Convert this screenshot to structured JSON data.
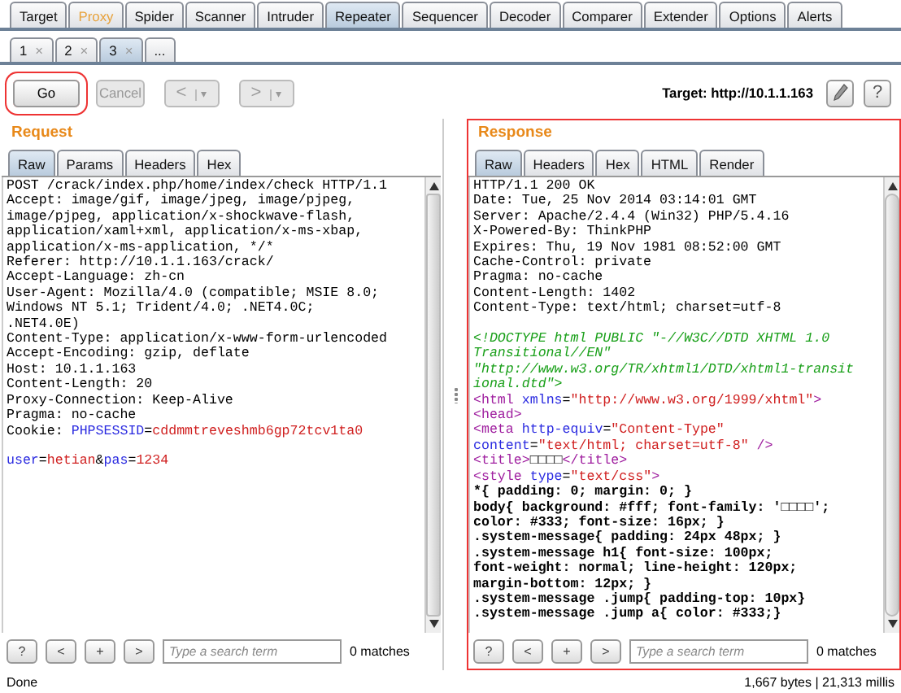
{
  "main_tabs": [
    {
      "label": "Target",
      "selected": false,
      "alert": false
    },
    {
      "label": "Proxy",
      "selected": false,
      "alert": true
    },
    {
      "label": "Spider",
      "selected": false,
      "alert": false
    },
    {
      "label": "Scanner",
      "selected": false,
      "alert": false
    },
    {
      "label": "Intruder",
      "selected": false,
      "alert": false
    },
    {
      "label": "Repeater",
      "selected": true,
      "alert": false
    },
    {
      "label": "Sequencer",
      "selected": false,
      "alert": false
    },
    {
      "label": "Decoder",
      "selected": false,
      "alert": false
    },
    {
      "label": "Comparer",
      "selected": false,
      "alert": false
    },
    {
      "label": "Extender",
      "selected": false,
      "alert": false
    },
    {
      "label": "Options",
      "selected": false,
      "alert": false
    },
    {
      "label": "Alerts",
      "selected": false,
      "alert": false
    }
  ],
  "sub_tabs": [
    {
      "label": "1",
      "close": "×",
      "selected": false
    },
    {
      "label": "2",
      "close": "×",
      "selected": false
    },
    {
      "label": "3",
      "close": "×",
      "selected": true
    },
    {
      "label": "...",
      "selected": false
    }
  ],
  "toolbar": {
    "go": {
      "label": "Go",
      "highlighted": true
    },
    "cancel": {
      "label": "Cancel",
      "disabled": true
    },
    "back": {
      "label": "<",
      "menu": "▾"
    },
    "forward": {
      "label": ">",
      "menu": "▾"
    },
    "target": "Target: http://10.1.1.163",
    "help": "?"
  },
  "request": {
    "title": "Request",
    "highlighted": false,
    "tabs": [
      {
        "label": "Raw",
        "selected": true
      },
      {
        "label": "Params",
        "selected": false
      },
      {
        "label": "Headers",
        "selected": false
      },
      {
        "label": "Hex",
        "selected": false
      }
    ],
    "lines": [
      {
        "segments": [
          {
            "text": "POST /crack/index.php/home/index/check HTTP/1.1",
            "kind": "plain"
          }
        ]
      },
      {
        "segments": [
          {
            "text": "Accept: image/gif, image/jpeg, image/pjpeg,",
            "kind": "plain"
          }
        ]
      },
      {
        "segments": [
          {
            "text": "image/pjpeg, application/x-shockwave-flash,",
            "kind": "plain"
          }
        ]
      },
      {
        "segments": [
          {
            "text": "application/xaml+xml, application/x-ms-xbap,",
            "kind": "plain"
          }
        ]
      },
      {
        "segments": [
          {
            "text": "application/x-ms-application, */*",
            "kind": "plain"
          }
        ]
      },
      {
        "segments": [
          {
            "text": "Referer: http://10.1.1.163/crack/",
            "kind": "plain"
          }
        ]
      },
      {
        "segments": [
          {
            "text": "Accept-Language: zh-cn",
            "kind": "plain"
          }
        ]
      },
      {
        "segments": [
          {
            "text": "User-Agent: Mozilla/4.0 (compatible; MSIE 8.0;",
            "kind": "plain"
          }
        ]
      },
      {
        "segments": [
          {
            "text": "Windows NT 5.1; Trident/4.0; .NET4.0C;",
            "kind": "plain"
          }
        ]
      },
      {
        "segments": [
          {
            "text": ".NET4.0E)",
            "kind": "plain"
          }
        ]
      },
      {
        "segments": [
          {
            "text": "Content-Type: application/x-www-form-urlencoded",
            "kind": "plain"
          }
        ]
      },
      {
        "segments": [
          {
            "text": "Accept-Encoding: gzip, deflate",
            "kind": "plain"
          }
        ]
      },
      {
        "segments": [
          {
            "text": "Host: 10.1.1.163",
            "kind": "plain"
          }
        ]
      },
      {
        "segments": [
          {
            "text": "Content-Length: 20",
            "kind": "plain"
          }
        ]
      },
      {
        "segments": [
          {
            "text": "Proxy-Connection: Keep-Alive",
            "kind": "plain"
          }
        ]
      },
      {
        "segments": [
          {
            "text": "Pragma: no-cache",
            "kind": "plain"
          }
        ]
      },
      {
        "segments": [
          {
            "text": "Cookie: ",
            "kind": "plain"
          },
          {
            "text": "PHPSESSID",
            "kind": "name"
          },
          {
            "text": "=",
            "kind": "plain"
          },
          {
            "text": "cddmmtreveshmb6gp72tcv1ta0",
            "kind": "value"
          }
        ]
      },
      {
        "blank_before": true,
        "segments": [
          {
            "text": "user",
            "kind": "name"
          },
          {
            "text": "=",
            "kind": "plain"
          },
          {
            "text": "hetian",
            "kind": "value"
          },
          {
            "text": "&",
            "kind": "plain"
          },
          {
            "text": "pas",
            "kind": "name"
          },
          {
            "text": "=",
            "kind": "plain"
          },
          {
            "text": "1234",
            "kind": "value"
          }
        ]
      }
    ],
    "search": {
      "help": "?",
      "prev": "<",
      "add": "+",
      "next": ">",
      "placeholder": "Type a search term",
      "matches": "0 matches"
    }
  },
  "response": {
    "title": "Response",
    "highlighted": true,
    "tabs": [
      {
        "label": "Raw",
        "selected": true
      },
      {
        "label": "Headers",
        "selected": false
      },
      {
        "label": "Hex",
        "selected": false
      },
      {
        "label": "HTML",
        "selected": false
      },
      {
        "label": "Render",
        "selected": false
      }
    ],
    "lines": [
      {
        "segments": [
          {
            "text": "HTTP/1.1 200 OK",
            "kind": "plain"
          }
        ]
      },
      {
        "segments": [
          {
            "text": "Date: Tue, 25 Nov 2014 03:14:01 GMT",
            "kind": "plain"
          }
        ]
      },
      {
        "segments": [
          {
            "text": "Server: Apache/2.4.4 (Win32) PHP/5.4.16",
            "kind": "plain"
          }
        ]
      },
      {
        "segments": [
          {
            "text": "X-Powered-By: ThinkPHP",
            "kind": "plain"
          }
        ]
      },
      {
        "segments": [
          {
            "text": "Expires: Thu, 19 Nov 1981 08:52:00 GMT",
            "kind": "plain"
          }
        ]
      },
      {
        "segments": [
          {
            "text": "Cache-Control: private",
            "kind": "plain"
          }
        ]
      },
      {
        "segments": [
          {
            "text": "Pragma: no-cache",
            "kind": "plain"
          }
        ]
      },
      {
        "segments": [
          {
            "text": "Content-Length: 1402",
            "kind": "plain"
          }
        ]
      },
      {
        "segments": [
          {
            "text": "Content-Type: text/html; charset=utf-8",
            "kind": "plain"
          }
        ]
      },
      {
        "blank_before": true,
        "segments": [
          {
            "text": "<!DOCTYPE html PUBLIC \"-//W3C//DTD XHTML 1.0",
            "kind": "comment"
          }
        ]
      },
      {
        "segments": [
          {
            "text": "Transitional//EN\"",
            "kind": "comment"
          }
        ]
      },
      {
        "segments": [
          {
            "text": "\"http://www.w3.org/TR/xhtml1/DTD/xhtml1-transit",
            "kind": "comment"
          }
        ]
      },
      {
        "segments": [
          {
            "text": "ional.dtd\">",
            "kind": "comment"
          }
        ]
      },
      {
        "segments": [
          {
            "text": "<html",
            "kind": "tag"
          },
          {
            "text": " xmlns",
            "kind": "name"
          },
          {
            "text": "=",
            "kind": "plain"
          },
          {
            "text": "\"http://www.w3.org/1999/xhtml\"",
            "kind": "value"
          },
          {
            "text": ">",
            "kind": "tag"
          }
        ]
      },
      {
        "segments": [
          {
            "text": "<head>",
            "kind": "tag"
          }
        ]
      },
      {
        "segments": [
          {
            "text": "<meta",
            "kind": "tag"
          },
          {
            "text": " http-equiv",
            "kind": "name"
          },
          {
            "text": "=",
            "kind": "plain"
          },
          {
            "text": "\"Content-Type\"",
            "kind": "value"
          }
        ]
      },
      {
        "segments": [
          {
            "text": "content",
            "kind": "name"
          },
          {
            "text": "=",
            "kind": "plain"
          },
          {
            "text": "\"text/html; charset=utf-8\"",
            "kind": "value"
          },
          {
            "text": " />",
            "kind": "tag"
          }
        ]
      },
      {
        "segments": [
          {
            "text": "<title>",
            "kind": "tag"
          },
          {
            "text": "□□□□",
            "kind": "plain"
          },
          {
            "text": "</title>",
            "kind": "tag"
          }
        ]
      },
      {
        "segments": [
          {
            "text": "<style",
            "kind": "tag"
          },
          {
            "text": " type",
            "kind": "name"
          },
          {
            "text": "=",
            "kind": "plain"
          },
          {
            "text": "\"text/css\"",
            "kind": "value"
          },
          {
            "text": ">",
            "kind": "tag"
          }
        ]
      },
      {
        "segments": [
          {
            "text": "*{ padding: 0; margin: 0; }",
            "kind": "bold"
          }
        ]
      },
      {
        "segments": [
          {
            "text": "body{ background: #fff; font-family: '□□□□';",
            "kind": "bold"
          }
        ]
      },
      {
        "segments": [
          {
            "text": "color: #333; font-size: 16px; }",
            "kind": "bold"
          }
        ]
      },
      {
        "segments": [
          {
            "text": ".system-message{ padding: 24px 48px; }",
            "kind": "bold"
          }
        ]
      },
      {
        "segments": [
          {
            "text": ".system-message h1{ font-size: 100px;",
            "kind": "bold"
          }
        ]
      },
      {
        "segments": [
          {
            "text": "font-weight: normal; line-height: 120px;",
            "kind": "bold"
          }
        ]
      },
      {
        "segments": [
          {
            "text": "margin-bottom: 12px; }",
            "kind": "bold"
          }
        ]
      },
      {
        "segments": [
          {
            "text": ".system-message .jump{ padding-top: 10px}",
            "kind": "bold"
          }
        ]
      },
      {
        "segments": [
          {
            "text": ".system-message .jump a{ color: #333;}",
            "kind": "bold"
          }
        ]
      }
    ],
    "search": {
      "help": "?",
      "prev": "<",
      "add": "+",
      "next": ">",
      "placeholder": "Type a search term",
      "matches": "0 matches"
    }
  },
  "status_bar": {
    "left": "Done",
    "right": "1,667 bytes | 21,313 millis"
  }
}
